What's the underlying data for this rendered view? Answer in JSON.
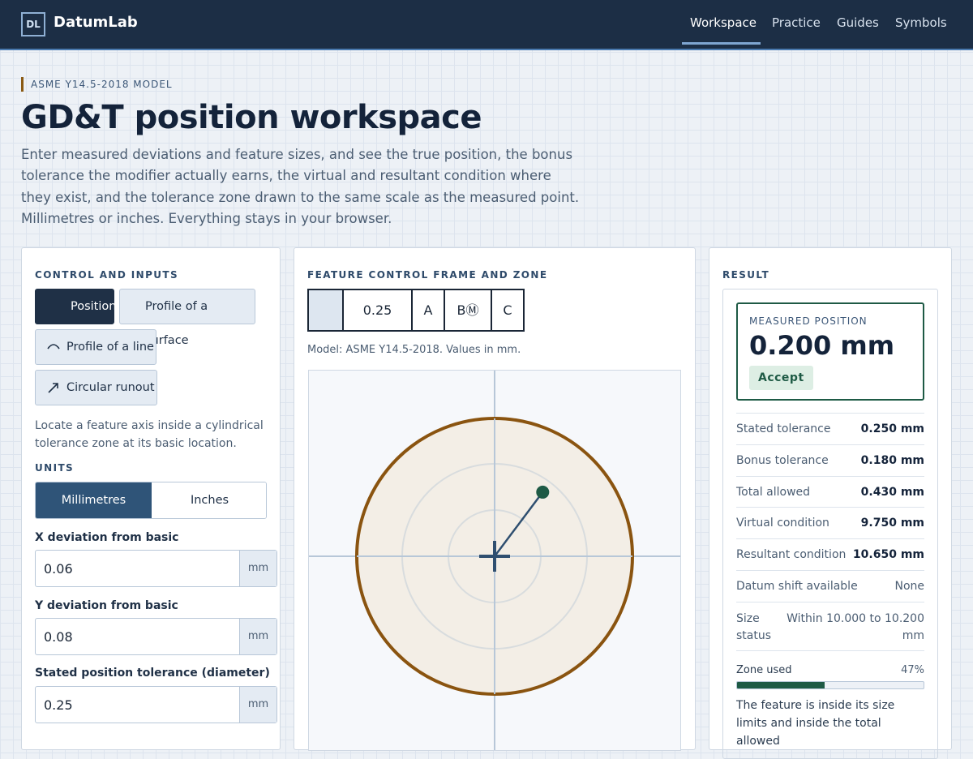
{
  "app": {
    "logo": "DL",
    "name": "DatumLab",
    "nav": [
      {
        "label": "Workspace",
        "active": true
      },
      {
        "label": "Practice",
        "active": false
      },
      {
        "label": "Guides",
        "active": false
      },
      {
        "label": "Symbols",
        "active": false
      }
    ]
  },
  "hero": {
    "eyebrow": "ASME Y14.5-2018 MODEL",
    "title": "GD&T position workspace",
    "description": "Enter measured deviations and feature sizes, and see the true position, the bonus tolerance the modifier actually earns, the virtual and resultant condition where they exist, and the tolerance zone drawn to the same scale as the measured point. Millimetres or inches. Everything stays in your browser."
  },
  "controls": {
    "heading": "CONTROL AND INPUTS",
    "types": [
      {
        "label": "Position",
        "icon": "position-icon",
        "active": true
      },
      {
        "label": "Profile of a surface",
        "icon": "profile-surface-icon",
        "active": false
      },
      {
        "label": "Profile of a line",
        "icon": "profile-line-icon",
        "active": false
      },
      {
        "label": "Circular runout",
        "icon": "circular-runout-icon",
        "active": false
      }
    ],
    "description": "Locate a feature axis inside a cylindrical tolerance zone at its basic location.",
    "units_heading": "UNITS",
    "units": [
      {
        "label": "Millimetres",
        "active": true
      },
      {
        "label": "Inches",
        "active": false
      }
    ],
    "fields": [
      {
        "label": "X deviation from basic",
        "value": "0.06",
        "unit": "mm"
      },
      {
        "label": "Y deviation from basic",
        "value": "0.08",
        "unit": "mm"
      },
      {
        "label": "Stated position tolerance (diameter)",
        "value": "0.25",
        "unit": "mm"
      }
    ]
  },
  "frame": {
    "heading": "FEATURE CONTROL FRAME AND ZONE",
    "cells": [
      "0.25",
      "A",
      "BⓂ",
      "C"
    ],
    "note": "Model: ASME Y14.5-2018. Values in mm.",
    "zone": {
      "stated_tolerance": 0.25,
      "total_allowed": 0.43,
      "measured_x": 0.06,
      "measured_y": 0.08,
      "zone_color": "#8a5410",
      "zone_fill": "#f3eee6",
      "point_color": "#1e5a45",
      "vector_color": "#2f4f70"
    }
  },
  "result": {
    "heading": "RESULT",
    "measured_label": "MEASURED POSITION",
    "measured_value": "0.200 mm",
    "verdict": "Accept",
    "rows": [
      {
        "key": "Stated tolerance",
        "value": "0.250 mm"
      },
      {
        "key": "Bonus tolerance",
        "value": "0.180 mm"
      },
      {
        "key": "Total allowed",
        "value": "0.430 mm"
      },
      {
        "key": "Virtual condition",
        "value": "9.750 mm"
      },
      {
        "key": "Resultant condition",
        "value": "10.650 mm"
      },
      {
        "key": "Datum shift available",
        "value": "None"
      },
      {
        "key": "Size status",
        "value": "Within 10.000 to 10.200 mm"
      }
    ],
    "zone_used_label": "Zone used",
    "zone_used_value": "47%",
    "zone_used_fraction": 0.47,
    "summary": "The feature is inside its size limits and inside the total allowed"
  },
  "colors": {
    "header_bg": "#1c2e45",
    "accent": "#2f5478",
    "accept": "#1e5a45",
    "zone_boundary": "#8a5410"
  }
}
